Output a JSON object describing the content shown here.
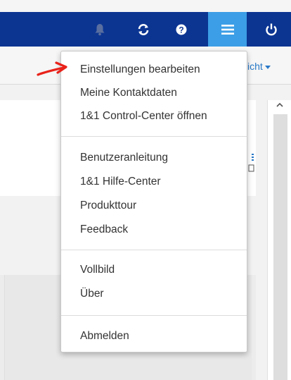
{
  "topbar": {
    "icons": [
      "bell-icon",
      "refresh-icon",
      "help-icon",
      "menu-icon",
      "power-icon"
    ],
    "active_color": "#3c9ee6",
    "bar_color": "#0c3592"
  },
  "subbar": {
    "view_label": "icht"
  },
  "menu": {
    "group1": [
      "Einstellungen bearbeiten",
      "Meine Kontaktdaten",
      "1&1 Control-Center öffnen"
    ],
    "group2": [
      "Benutzeranleitung",
      "1&1 Hilfe-Center",
      "Produkttour",
      "Feedback"
    ],
    "group3": [
      "Vollbild",
      "Über"
    ],
    "group4": [
      "Abmelden"
    ]
  },
  "annotation": {
    "arrow_color": "#e8221a"
  }
}
